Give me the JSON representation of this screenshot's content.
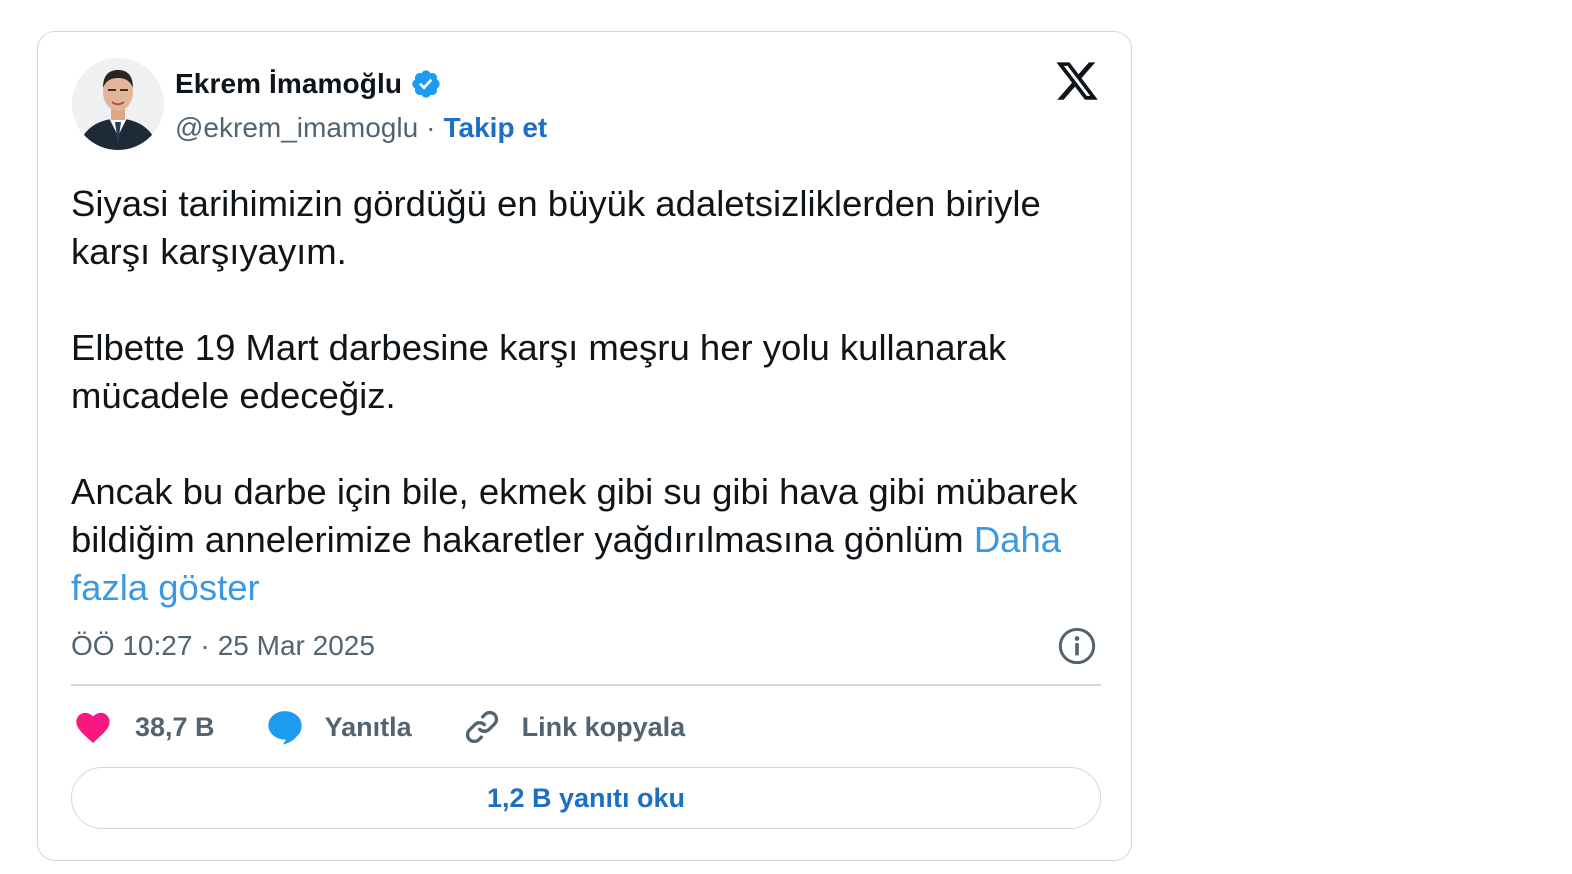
{
  "author": {
    "name": "Ekrem İmamoğlu",
    "handle": "@ekrem_imamoglu",
    "separator": "·",
    "follow_label": "Takip et",
    "verified_icon": "verified-badge-icon",
    "avatar_icon": "profile-photo"
  },
  "brand": {
    "logo_icon": "x-logo-icon"
  },
  "tweet": {
    "paragraph_1": "Siyasi tarihimizin gördüğü en büyük adaletsizliklerden biriyle karşı karşıyayım.",
    "paragraph_2": "Elbette 19 Mart darbesine karşı meşru her yolu kullanarak mücadele edeceğiz.",
    "paragraph_3": "Ancak bu darbe için bile, ekmek gibi su gibi hava gibi mübarek bildiğim annelerimize hakaretler yağdırılmasına gönlüm",
    "show_more": "Daha fazla göster"
  },
  "meta": {
    "time": "ÖÖ 10:27",
    "separator": "·",
    "date": "25 Mar 2025",
    "info_icon": "info-icon"
  },
  "actions": {
    "like_count": "38,7 B",
    "reply_label": "Yanıtla",
    "copy_link_label": "Link kopyala"
  },
  "read_replies_label": "1,2 B yanıtı oku",
  "colors": {
    "text": "#0f1419",
    "muted": "#536471",
    "link": "#1d6fc4",
    "show_more": "#3a99e0",
    "like": "#f91880",
    "reply": "#1d9bf0",
    "verified": "#1d9bf0",
    "border": "#cfd9de"
  }
}
